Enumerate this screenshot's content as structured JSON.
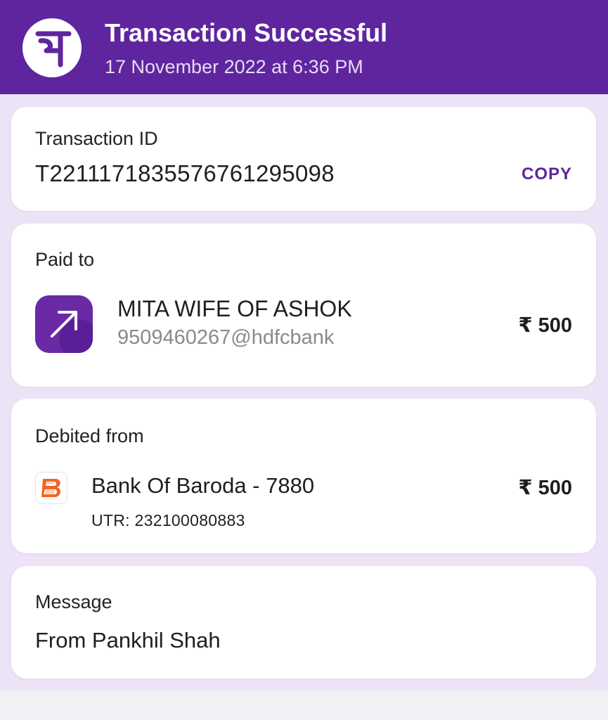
{
  "header": {
    "logo_glyph": "पे",
    "title": "Transaction Successful",
    "datetime": "17 November 2022 at 6:36 PM",
    "background_color": "#5f259f"
  },
  "transaction": {
    "label": "Transaction ID",
    "id": "T2211171835576761295098",
    "copy_label": "COPY"
  },
  "paid_to": {
    "label": "Paid to",
    "icon": "arrow-up-right-icon",
    "name": "MITA WIFE OF ASHOK",
    "upi_id": "9509460267@hdfcbank",
    "amount": "₹ 500"
  },
  "debited_from": {
    "label": "Debited from",
    "bank_icon": "bank-of-baroda-logo",
    "bank_name": "Bank Of Baroda - 7880",
    "utr": "UTR: 232100080883",
    "amount": "₹ 500"
  },
  "message": {
    "label": "Message",
    "text": "From Pankhil Shah"
  },
  "colors": {
    "accent": "#5f259f",
    "page_background": "#ece4f6",
    "card_background": "#ffffff"
  }
}
